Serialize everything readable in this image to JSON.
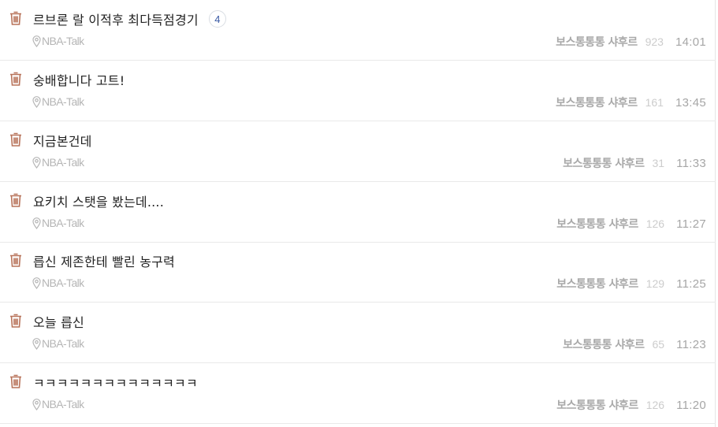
{
  "posts": [
    {
      "title": "르브론 랄 이적후 최다득점경기",
      "comments": "4",
      "board": "NBA-Talk",
      "author": "보스통통통 샤후르",
      "views": "923",
      "time": "14:01"
    },
    {
      "title": "숭배합니다 고트!",
      "comments": "",
      "board": "NBA-Talk",
      "author": "보스통통통 샤후르",
      "views": "161",
      "time": "13:45"
    },
    {
      "title": "지금본건데",
      "comments": "",
      "board": "NBA-Talk",
      "author": "보스통통통 샤후르",
      "views": "31",
      "time": "11:33"
    },
    {
      "title": "요키치 스탯을 봤는데....",
      "comments": "",
      "board": "NBA-Talk",
      "author": "보스통통통 샤후르",
      "views": "126",
      "time": "11:27"
    },
    {
      "title": "릅신 제존한테 빨린 농구력",
      "comments": "",
      "board": "NBA-Talk",
      "author": "보스통통통 샤후르",
      "views": "129",
      "time": "11:25"
    },
    {
      "title": "오늘 릅신",
      "comments": "",
      "board": "NBA-Talk",
      "author": "보스통통통 샤후르",
      "views": "65",
      "time": "11:23"
    },
    {
      "title": "ㅋㅋㅋㅋㅋㅋㅋㅋㅋㅋㅋㅋㅋㅋ",
      "comments": "",
      "board": "NBA-Talk",
      "author": "보스통통통 샤후르",
      "views": "126",
      "time": "11:20"
    }
  ],
  "icons": {
    "delete": "trash-icon",
    "location": "location-pin-icon"
  },
  "colors": {
    "trash": "#b8735a",
    "badge_text": "#3b5ba5",
    "author": "#a9a9a9"
  }
}
